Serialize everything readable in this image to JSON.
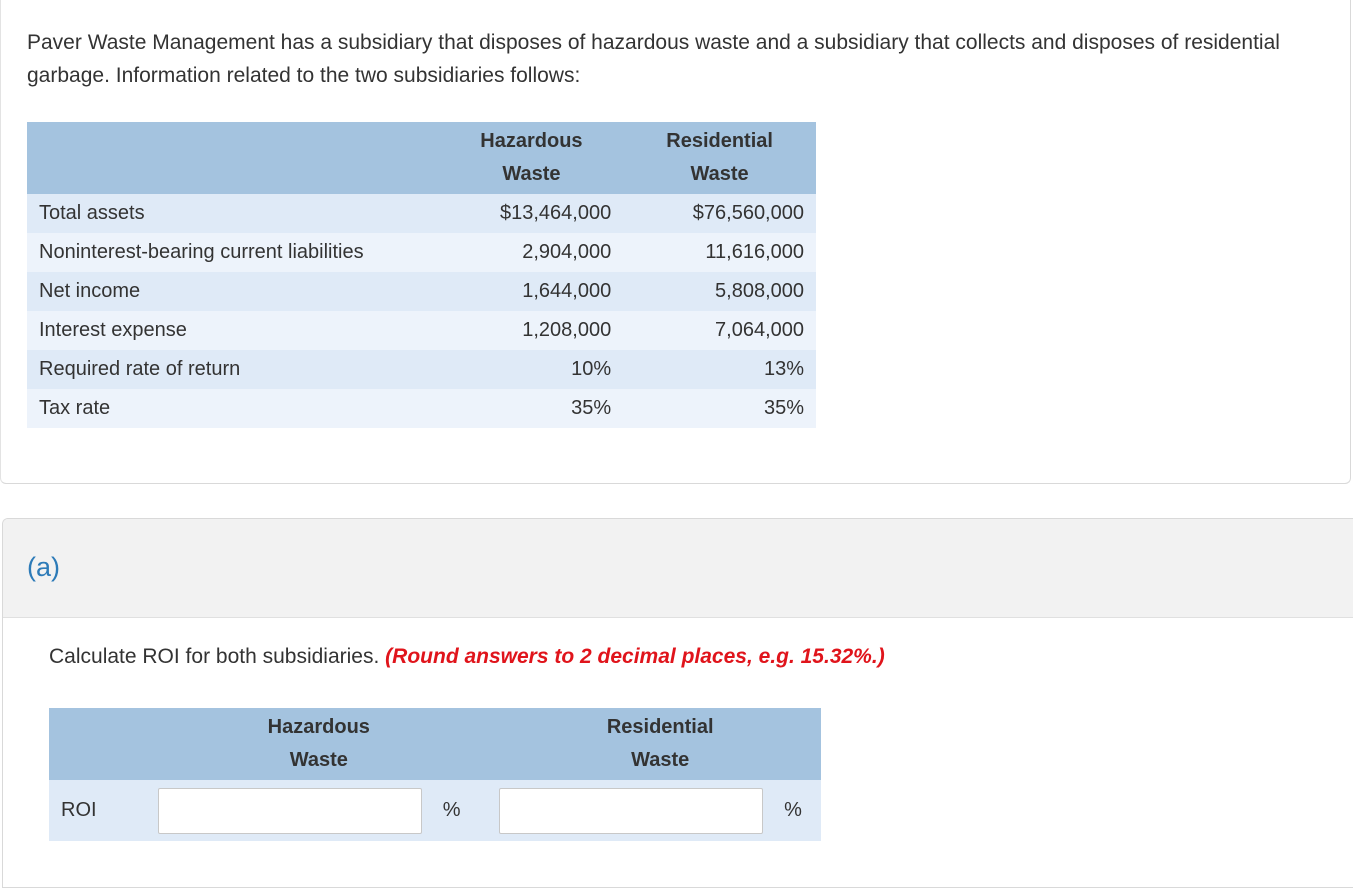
{
  "intro": "Paver Waste Management has a subsidiary that disposes of hazardous waste and a subsidiary that collects and disposes of residential garbage. Information related to the two subsidiaries follows:",
  "data_table": {
    "headers": {
      "col1_line1": "Hazardous",
      "col1_line2": "Waste",
      "col2_line1": "Residential",
      "col2_line2": "Waste"
    },
    "rows": [
      {
        "label": "Total assets",
        "hazardous": "$13,464,000",
        "residential": "$76,560,000"
      },
      {
        "label": "Noninterest-bearing current liabilities",
        "hazardous": "2,904,000",
        "residential": "11,616,000"
      },
      {
        "label": "Net income",
        "hazardous": "1,644,000",
        "residential": "5,808,000"
      },
      {
        "label": "Interest expense",
        "hazardous": "1,208,000",
        "residential": "7,064,000"
      },
      {
        "label": "Required rate of return",
        "hazardous": "10%",
        "residential": "13%"
      },
      {
        "label": "Tax rate",
        "hazardous": "35%",
        "residential": "35%"
      }
    ]
  },
  "part": "(a)",
  "instruction": "Calculate ROI for both subsidiaries.",
  "instruction_note": "(Round answers to 2 decimal places, e.g. 15.32%.)",
  "answer_table": {
    "headers": {
      "col1_line1": "Hazardous",
      "col1_line2": "Waste",
      "col2_line1": "Residential",
      "col2_line2": "Waste"
    },
    "row_label": "ROI",
    "hazardous_value": "",
    "residential_value": "",
    "unit": "%"
  },
  "colors": {
    "header_bg": "#a4c3df",
    "row_alt": "#dfeaf7",
    "note_red": "#e0141b",
    "part_blue": "#2d7bb8"
  }
}
